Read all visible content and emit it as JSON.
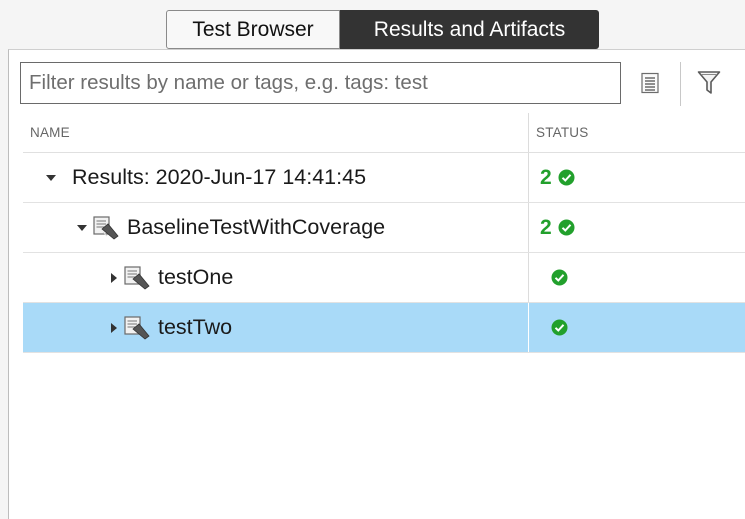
{
  "tabs": [
    {
      "label": "Test Browser",
      "active": false
    },
    {
      "label": "Results and Artifacts",
      "active": true
    }
  ],
  "filter": {
    "value": "",
    "placeholder": "Filter results by name or tags, e.g. tags: test"
  },
  "toolbar": {
    "icons": [
      "list-view-icon",
      "funnel-filter-icon"
    ]
  },
  "table": {
    "columns": [
      "NAME",
      "STATUS"
    ],
    "rows": [
      {
        "label": "Results: 2020-Jun-17 14:41:45",
        "count": "2",
        "status": "passed",
        "expanded": true,
        "selected": false
      },
      {
        "label": "BaselineTestWithCoverage",
        "count": "2",
        "status": "passed",
        "expanded": true,
        "selected": false
      },
      {
        "label": "testOne",
        "count": "",
        "status": "passed",
        "expanded": false,
        "selected": false
      },
      {
        "label": "testTwo",
        "count": "",
        "status": "passed",
        "expanded": false,
        "selected": true
      }
    ]
  },
  "colors": {
    "active_tab": "#333333",
    "selected_row": "#a9daf8",
    "passed_green": "#22a02c"
  }
}
